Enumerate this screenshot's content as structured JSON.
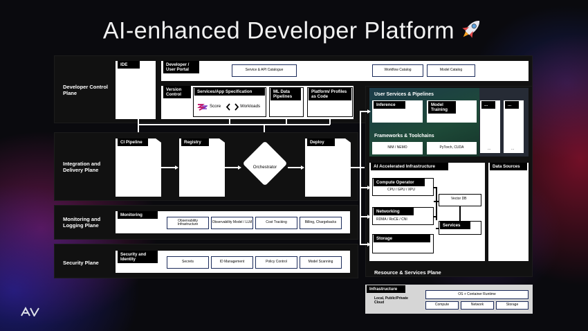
{
  "title": "AI-enhanced Developer Platform",
  "logo": "AV",
  "planes": {
    "developer_control": "Developer Control Plane",
    "integration_delivery": "Integration and Delivery Plane",
    "monitoring_logging": "Monitoring and Logging Plane",
    "security": "Security Plane",
    "resource_services": "Resource & Services Plane"
  },
  "developer": {
    "ide": "IDE",
    "portal": "Developer / User Portal",
    "portal_items": [
      "Service & API Catalogue",
      "Workflow Catalog",
      "Model Catalog"
    ],
    "version_control": "Version Control",
    "spec": "Services/App Specification",
    "score": "Score",
    "workloads": "Workloads",
    "ml_pipelines": "ML Data Pipelines",
    "profiles": "Platform/ Profiles as Code"
  },
  "integration": {
    "ci": "CI Pipeline",
    "registry": "Registry",
    "orchestrator": "Orchestrator",
    "deploy": "Deploy"
  },
  "monitoring": {
    "label": "Monitoring",
    "items": [
      "Observability Infrastructure",
      "Observability Model / LLM",
      "Cost Tracking",
      "Billing, Chargebacks"
    ]
  },
  "security": {
    "label": "Security and Identity",
    "items": [
      "Secrets",
      "ID Management",
      "Policy Control",
      "Model Scanning"
    ]
  },
  "user_services": {
    "title": "User Services & Pipelines",
    "inference": "Inference",
    "training": "Model Training",
    "more1": "...",
    "more2": "...",
    "frameworks": "Frameworks & Toolchains",
    "nim": "NIM / NEMO",
    "pytorch": "PyTorch, CUDA",
    "dots1": "...",
    "dots2": "..."
  },
  "ai_infra": {
    "title": "AI Accelerated Infrastructure",
    "compute": "Compute Operator",
    "compute_sub": "CPU / GPU / XPU",
    "vector_db": "Vector DB",
    "networking": "Networking",
    "networking_sub": "RDMA / RoCE / CNI",
    "services": "Services",
    "storage": "Storage"
  },
  "data_sources": "Data Sources",
  "infrastructure": {
    "title": "Infrastructure",
    "location": "Local, Public/Private Cloud",
    "runtime": "OS + Container Runtime",
    "items": [
      "Compute",
      "Network",
      "Storage"
    ]
  },
  "colors": {
    "background": "#0a0a0e",
    "plane": "#111111",
    "pill_border": "#1a2a5a",
    "user_services_green": "#1f4a3a"
  }
}
